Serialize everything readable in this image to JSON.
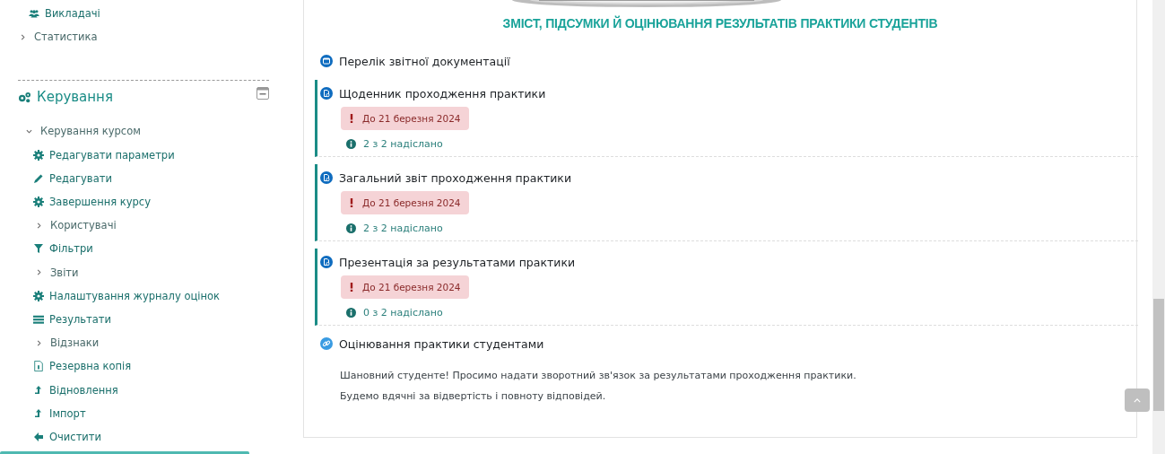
{
  "sidebar": {
    "items": [
      {
        "kind": "link",
        "label": "Викладачі"
      },
      {
        "kind": "branch",
        "label": "Статистика",
        "expanded": false
      }
    ],
    "block": {
      "title": "Керування",
      "collapsed": false
    },
    "management": {
      "label": "Керування курсом",
      "expanded": true,
      "children": [
        {
          "kind": "link",
          "label": "Редагувати параметри"
        },
        {
          "kind": "link",
          "label": "Редагувати"
        },
        {
          "kind": "link",
          "label": "Завершення курсу"
        },
        {
          "kind": "branch",
          "label": "Користувачі",
          "expanded": false
        },
        {
          "kind": "link",
          "label": "Фільтри"
        },
        {
          "kind": "branch",
          "label": "Звіти",
          "expanded": false
        },
        {
          "kind": "link",
          "label": "Налаштування журналу оцінок"
        },
        {
          "kind": "link",
          "label": "Результати"
        },
        {
          "kind": "branch",
          "label": "Відзнаки",
          "expanded": false
        },
        {
          "kind": "link",
          "label": "Резервна копія"
        },
        {
          "kind": "link",
          "label": "Відновлення"
        },
        {
          "kind": "link",
          "label": "Імпорт"
        },
        {
          "kind": "link",
          "label": "Очистити"
        }
      ]
    }
  },
  "section": {
    "title": "ЗМІСТ, ПІДСУМКИ Й ОЦІНЮВАННЯ РЕЗУЛЬТАТІВ ПРАКТИКИ СТУДЕНТІВ",
    "activities": [
      {
        "kind": "page",
        "title": "Перелік звітної документації"
      },
      {
        "kind": "assignment",
        "title": "Щоденник проходження практики",
        "due": "До 21 березня 2024",
        "submitted": "2 з 2 надіслано"
      },
      {
        "kind": "assignment",
        "title": "Загальний звіт проходження практики",
        "due": "До 21 березня 2024",
        "submitted": "2 з 2 надіслано"
      },
      {
        "kind": "assignment",
        "title": "Презентація за результатами практики",
        "due": "До 21 березня 2024",
        "submitted": "0 з 2 надіслано"
      },
      {
        "kind": "feedback",
        "title": "Оцінювання практики студентами",
        "description": [
          "Шановний студенте! Просимо надати зворотний зв'язок за результатами проходження практики.",
          "Будемо вдячні за відвертість і повноту відповідей."
        ]
      }
    ]
  }
}
